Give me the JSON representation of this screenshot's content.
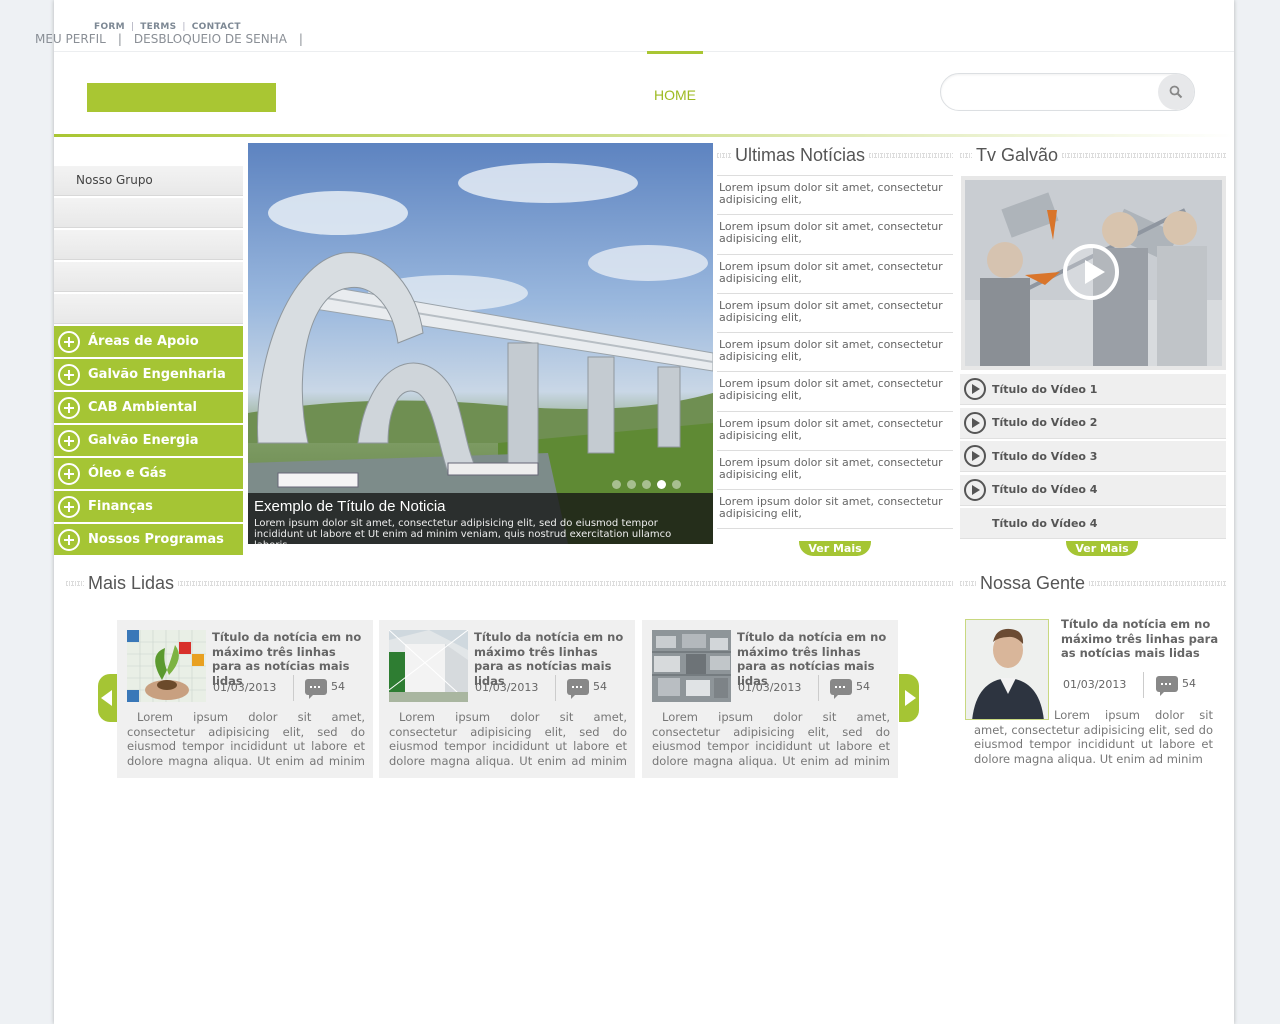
{
  "top_links": {
    "form": "FORM",
    "terms": "TERMS",
    "contact": "CONTACT",
    "separator": "|"
  },
  "user_links": {
    "perfil": "MEU PERFIL",
    "desbloqueio": "DESBLOQUEIO DE SENHA",
    "separator": "|"
  },
  "nav": {
    "home": "HOME"
  },
  "search": {
    "placeholder": ""
  },
  "left_menu": {
    "gray_items": [
      "Nosso Grupo",
      "",
      "",
      "",
      ""
    ],
    "green_items": [
      "Áreas de Apoio",
      "Galvão Engenharia",
      "CAB Ambiental",
      "Galvão Energia",
      "Óleo e Gás",
      "Finanças",
      "Nossos Programas"
    ]
  },
  "hero": {
    "title": "Exemplo de Título de Noticia",
    "text": "Lorem ipsum dolor sit amet, consectetur adipisicing elit, sed do eiusmod tempor incididunt ut labore et Ut enim ad minim veniam, quis nostrud exercitation ullamco laboris",
    "slide_count": 5,
    "active_slide": 4
  },
  "ultimas": {
    "heading": "Ultimas Notícias",
    "items": [
      "Lorem ipsum dolor sit amet, consectetur adipisicing elit,",
      "Lorem ipsum dolor sit amet, consectetur adipisicing elit,",
      "Lorem ipsum dolor sit amet, consectetur adipisicing elit,",
      "Lorem ipsum dolor sit amet, consectetur adipisicing elit,",
      "Lorem ipsum dolor sit amet, consectetur adipisicing elit,",
      "Lorem ipsum dolor sit amet, consectetur adipisicing elit,",
      "Lorem ipsum dolor sit amet, consectetur adipisicing elit,",
      "Lorem ipsum dolor sit amet, consectetur adipisicing elit,",
      "Lorem ipsum dolor sit amet, consectetur adipisicing elit,"
    ],
    "ver_mais": "Ver Mais"
  },
  "tv": {
    "heading": "Tv Galvão",
    "videos": [
      "Título do Vídeo 1",
      "Título do Vídeo 2",
      "Título do Vídeo 3",
      "Título do Vídeo 4",
      "Título do Vídeo 4"
    ],
    "ver_mais": "Ver Mais"
  },
  "mais_lidas": {
    "heading": "Mais Lidas",
    "cards": [
      {
        "title": "Título da notícia em no máximo três linhas para as notícias mais lidas",
        "date": "01/03/2013",
        "comments": "54",
        "text": "Lorem ipsum dolor sit amet, consectetur adipisicing elit, sed do eiusmod tempor incididunt ut labore et dolore magna aliqua. Ut enim ad minim veniam, quis"
      },
      {
        "title": "Título da notícia em no máximo três linhas para as notícias mais lidas",
        "date": "01/03/2013",
        "comments": "54",
        "text": "Lorem ipsum dolor sit amet, consectetur adipisicing elit, sed do eiusmod tempor incididunt ut labore et dolore magna aliqua. Ut enim ad minim veniam, quis"
      },
      {
        "title": "Título da notícia em no máximo três linhas para as notícias mais lidas",
        "date": "01/03/2013",
        "comments": "54",
        "text": "Lorem ipsum dolor sit amet, consectetur adipisicing elit, sed do eiusmod tempor incididunt ut labore et dolore magna aliqua. Ut enim ad minim veniam, quis"
      }
    ]
  },
  "nossa_gente": {
    "heading": "Nossa Gente",
    "title": "Título da notícia em no máximo três linhas para as notícias mais lidas",
    "date": "01/03/2013",
    "comments": "54",
    "text": "Lorem ipsum dolor sit amet, consectetur adipisicing elit, sed do eiusmod tempor incididunt ut labore et dolore magna aliqua. Ut enim ad minim"
  },
  "colors": {
    "accent": "#a5c534",
    "nav_active": "#9ebb22",
    "text": "#555555"
  },
  "icons": {
    "search": "search-icon",
    "plus": "plus-circle-icon",
    "play": "play-circle-icon",
    "comment": "comment-icon",
    "arrow_left": "arrow-left-icon",
    "arrow_right": "arrow-right-icon"
  }
}
